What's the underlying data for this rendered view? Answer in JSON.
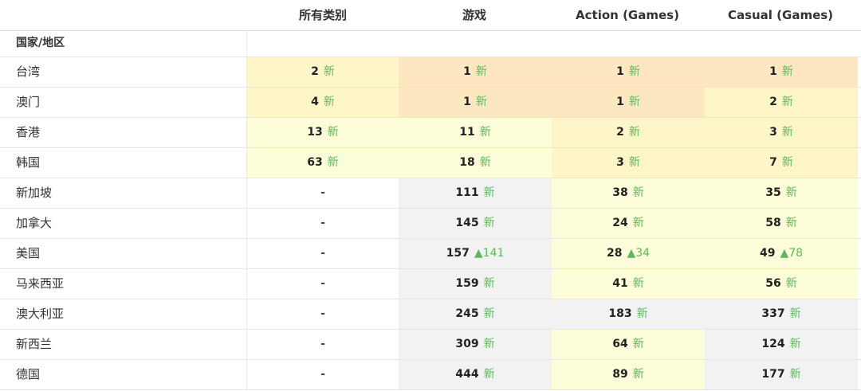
{
  "header": {
    "columns": [
      "所有类别",
      "游戏",
      "Action (Games)",
      "Casual (Games)"
    ]
  },
  "subheader": {
    "label": "国家/地区"
  },
  "colors": {
    "orange": "#fde7c0",
    "yellow": "#fef6c8",
    "lightyellow": "#fefdd9",
    "gray": "#f2f2f2",
    "white": "#ffffff",
    "green": "#5cb85c"
  },
  "rows": [
    {
      "country": "台湾",
      "cells": [
        {
          "rank": "2",
          "chg": "新",
          "bg": "yellow"
        },
        {
          "rank": "1",
          "chg": "新",
          "bg": "orange"
        },
        {
          "rank": "1",
          "chg": "新",
          "bg": "orange"
        },
        {
          "rank": "1",
          "chg": "新",
          "bg": "orange"
        }
      ]
    },
    {
      "country": "澳门",
      "cells": [
        {
          "rank": "4",
          "chg": "新",
          "bg": "yellow"
        },
        {
          "rank": "1",
          "chg": "新",
          "bg": "orange"
        },
        {
          "rank": "1",
          "chg": "新",
          "bg": "orange"
        },
        {
          "rank": "2",
          "chg": "新",
          "bg": "yellow"
        }
      ]
    },
    {
      "country": "香港",
      "cells": [
        {
          "rank": "13",
          "chg": "新",
          "bg": "lightyellow"
        },
        {
          "rank": "11",
          "chg": "新",
          "bg": "lightyellow"
        },
        {
          "rank": "2",
          "chg": "新",
          "bg": "yellow"
        },
        {
          "rank": "3",
          "chg": "新",
          "bg": "yellow"
        }
      ]
    },
    {
      "country": "韩国",
      "cells": [
        {
          "rank": "63",
          "chg": "新",
          "bg": "lightyellow"
        },
        {
          "rank": "18",
          "chg": "新",
          "bg": "lightyellow"
        },
        {
          "rank": "3",
          "chg": "新",
          "bg": "yellow"
        },
        {
          "rank": "7",
          "chg": "新",
          "bg": "yellow"
        }
      ]
    },
    {
      "country": "新加坡",
      "cells": [
        {
          "rank": "-",
          "chg": "",
          "bg": "white"
        },
        {
          "rank": "111",
          "chg": "新",
          "bg": "gray"
        },
        {
          "rank": "38",
          "chg": "新",
          "bg": "lightyellow"
        },
        {
          "rank": "35",
          "chg": "新",
          "bg": "lightyellow"
        }
      ]
    },
    {
      "country": "加拿大",
      "cells": [
        {
          "rank": "-",
          "chg": "",
          "bg": "white"
        },
        {
          "rank": "145",
          "chg": "新",
          "bg": "gray"
        },
        {
          "rank": "24",
          "chg": "新",
          "bg": "lightyellow"
        },
        {
          "rank": "58",
          "chg": "新",
          "bg": "lightyellow"
        }
      ]
    },
    {
      "country": "美国",
      "cells": [
        {
          "rank": "-",
          "chg": "",
          "bg": "white"
        },
        {
          "rank": "157",
          "chg": "▲141",
          "bg": "gray"
        },
        {
          "rank": "28",
          "chg": "▲34",
          "bg": "lightyellow"
        },
        {
          "rank": "49",
          "chg": "▲78",
          "bg": "lightyellow"
        }
      ]
    },
    {
      "country": "马来西亚",
      "cells": [
        {
          "rank": "-",
          "chg": "",
          "bg": "white"
        },
        {
          "rank": "159",
          "chg": "新",
          "bg": "gray"
        },
        {
          "rank": "41",
          "chg": "新",
          "bg": "lightyellow"
        },
        {
          "rank": "56",
          "chg": "新",
          "bg": "lightyellow"
        }
      ]
    },
    {
      "country": "澳大利亚",
      "cells": [
        {
          "rank": "-",
          "chg": "",
          "bg": "white"
        },
        {
          "rank": "245",
          "chg": "新",
          "bg": "gray"
        },
        {
          "rank": "183",
          "chg": "新",
          "bg": "gray"
        },
        {
          "rank": "337",
          "chg": "新",
          "bg": "gray"
        }
      ]
    },
    {
      "country": "新西兰",
      "cells": [
        {
          "rank": "-",
          "chg": "",
          "bg": "white"
        },
        {
          "rank": "309",
          "chg": "新",
          "bg": "gray"
        },
        {
          "rank": "64",
          "chg": "新",
          "bg": "lightyellow"
        },
        {
          "rank": "124",
          "chg": "新",
          "bg": "gray"
        }
      ]
    },
    {
      "country": "德国",
      "cells": [
        {
          "rank": "-",
          "chg": "",
          "bg": "white"
        },
        {
          "rank": "444",
          "chg": "新",
          "bg": "gray"
        },
        {
          "rank": "89",
          "chg": "新",
          "bg": "lightyellow"
        },
        {
          "rank": "177",
          "chg": "新",
          "bg": "gray"
        }
      ]
    }
  ]
}
